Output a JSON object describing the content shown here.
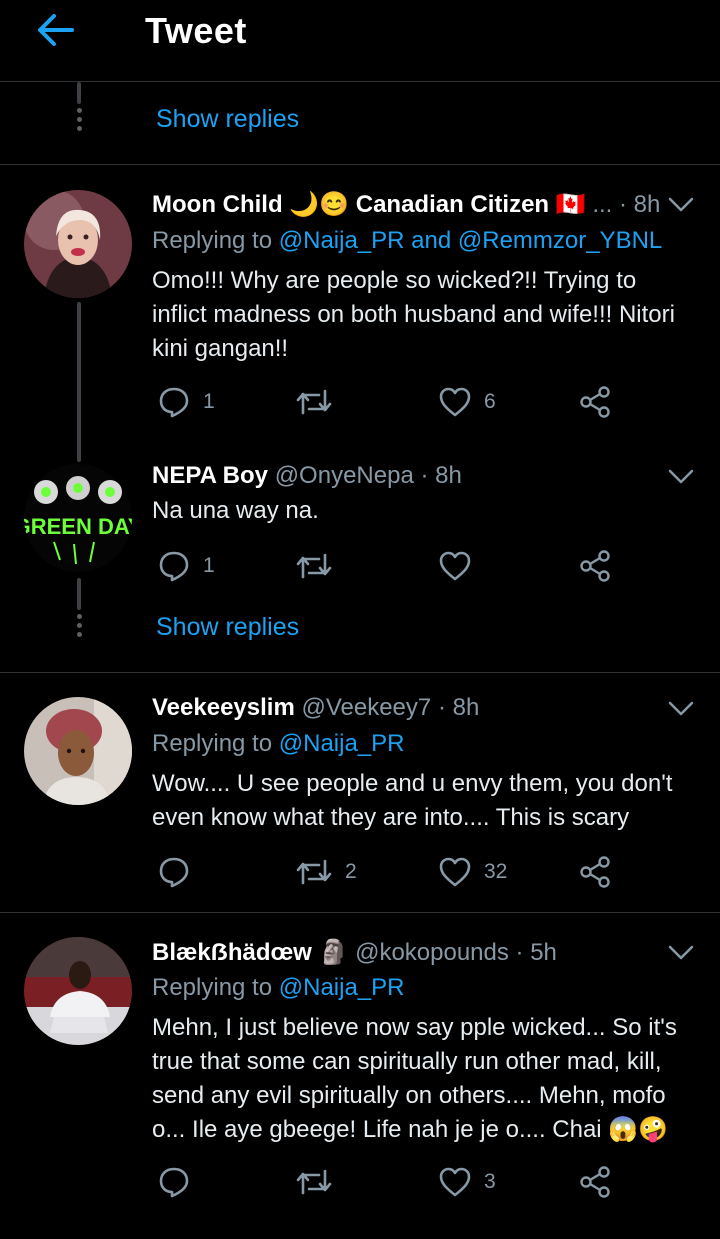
{
  "header": {
    "title": "Tweet"
  },
  "show_replies_top": "Show replies",
  "show_replies_mid": "Show replies",
  "tweets": [
    {
      "name": "Moon Child 🌙😊 Canadian Citizen 🇨🇦",
      "handle": "...",
      "time": "· 8h",
      "replying_prefix": "Replying to ",
      "replying_to": "@Naija_PR and @Remmzor_YBNL",
      "text": "Omo!!! Why are people so wicked?!! Trying to inflict madness on both husband and wife!!! Nitori kini gangan!!",
      "reply_count": "1",
      "retweet_count": "",
      "like_count": "6"
    },
    {
      "name": "NEPA Boy",
      "handle": "@OnyeNepa",
      "time": "· 8h",
      "text": "Na una way na.",
      "reply_count": "1",
      "retweet_count": "",
      "like_count": "",
      "avatar_text": "GREEN DAY"
    },
    {
      "name": "Veekeeyslim",
      "handle": "@Veekeey7",
      "time": "· 8h",
      "replying_prefix": "Replying to ",
      "replying_to": "@Naija_PR",
      "text": "Wow.... U see people and u envy them, you don't even know what they are into.... This is scary",
      "reply_count": "",
      "retweet_count": "2",
      "like_count": "32"
    },
    {
      "name": "Blækẞhädœw 🗿",
      "handle": "@kokopounds",
      "time": "· 5h",
      "replying_prefix": "Replying to ",
      "replying_to": "@Naija_PR",
      "text": "Mehn, I just believe now say pple wicked... So it's true that some can spiritually run other mad, kill, send any evil spiritually on others.... Mehn, mofo o... Ile aye gbeege! Life nah je je o.... Chai 😱🤪",
      "reply_count": "",
      "retweet_count": "",
      "like_count": "3"
    }
  ],
  "icons": {
    "back": "arrow-left-icon",
    "reply": "speech-bubble-icon",
    "retweet": "retweet-icon",
    "like": "heart-icon",
    "share": "share-icon",
    "more": "chevron-down-icon"
  },
  "colors": {
    "background": "#000000",
    "accent": "#1da1f2",
    "secondary_text": "#8899a6",
    "divider": "#2f3336"
  }
}
